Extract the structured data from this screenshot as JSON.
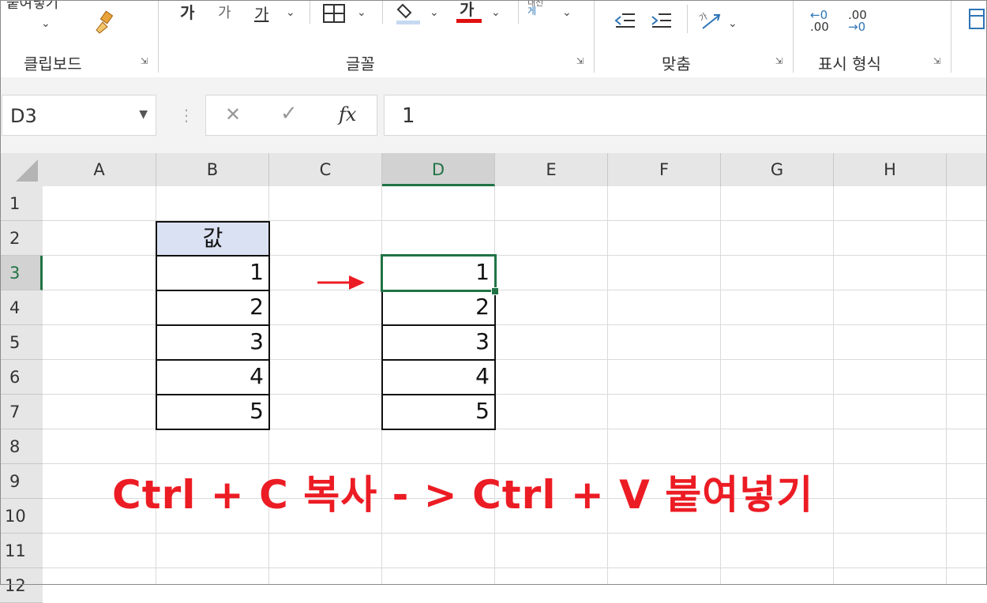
{
  "ribbon": {
    "clipboard": {
      "paste_label": "붙여넣기",
      "group_label": "클립보드"
    },
    "font": {
      "increase_size_label": "가",
      "decrease_size_label": "가",
      "underline_label": "가",
      "font_color_label": "가",
      "group_label": "글꼴"
    },
    "alignment": {
      "group_label": "맞춤",
      "text_direction_label": "내선"
    },
    "number": {
      "group_label": "표시 형식",
      "inc_decimal_label": ".00",
      "dec_decimal_label": ".0",
      "inc_left": "←0",
      "dec_right": "→0"
    }
  },
  "formula_bar": {
    "name_box": "D3",
    "cancel_icon": "✕",
    "enter_icon": "✓",
    "fx_label": "fx",
    "formula": "1"
  },
  "columns": [
    "A",
    "B",
    "C",
    "D",
    "E",
    "F",
    "G",
    "H"
  ],
  "rows": [
    "1",
    "2",
    "3",
    "4",
    "5",
    "6",
    "7",
    "8",
    "9",
    "10",
    "11",
    "12"
  ],
  "sheet": {
    "b2_header": "값",
    "source_values": [
      "1",
      "2",
      "3",
      "4",
      "5"
    ],
    "pasted_values": [
      "1",
      "2",
      "3",
      "4",
      "5"
    ]
  },
  "annotation": {
    "text": "Ctrl + C 복사 - > Ctrl + V 붙여넣기",
    "color": "#ec1c24"
  },
  "colors": {
    "accent": "#217346",
    "header_fill": "#d9e1f2",
    "annotation": "#ec1c24"
  }
}
